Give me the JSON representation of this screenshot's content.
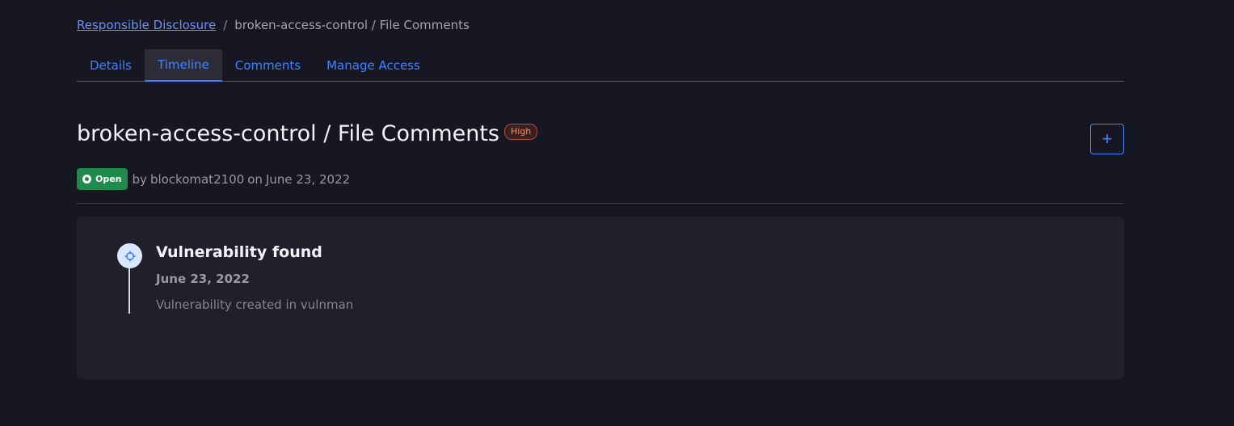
{
  "breadcrumb": {
    "parent": "Responsible Disclosure",
    "separator": "/",
    "current": "broken-access-control / File Comments"
  },
  "tabs": [
    {
      "label": "Details",
      "active": false
    },
    {
      "label": "Timeline",
      "active": true
    },
    {
      "label": "Comments",
      "active": false
    },
    {
      "label": "Manage Access",
      "active": false
    }
  ],
  "header": {
    "title": "broken-access-control / File Comments",
    "severity": "High",
    "add_label": "+"
  },
  "meta": {
    "status": "Open",
    "by_prefix": "by",
    "author": "blockomat2100",
    "on_prefix": "on",
    "date": "June 23, 2022"
  },
  "timeline": [
    {
      "title": "Vulnerability found",
      "date": "June 23, 2022",
      "description": "Vulnerability created in vulnman",
      "icon": "crosshair-icon"
    }
  ],
  "colors": {
    "background": "#171723",
    "accent": "#3f82ff",
    "status_open": "#1e8a4c",
    "severity_high": "#ff8c69",
    "card": "#20202c"
  }
}
